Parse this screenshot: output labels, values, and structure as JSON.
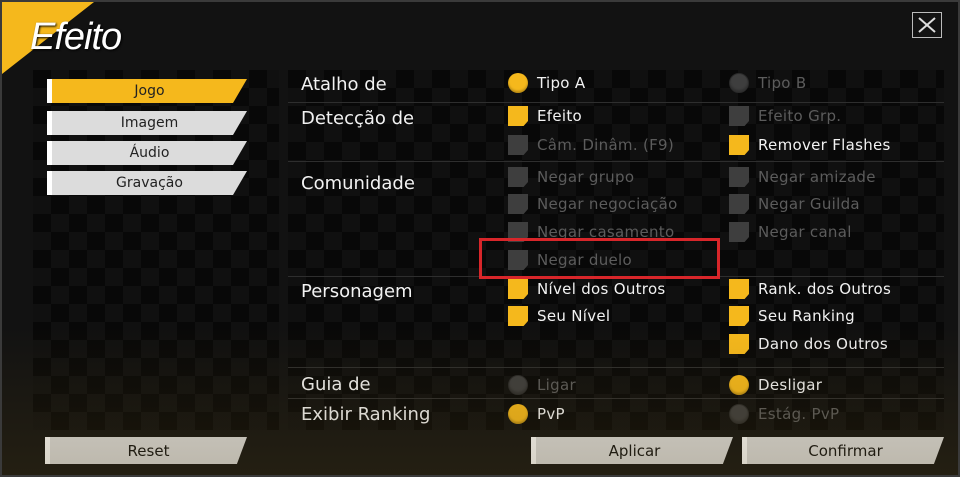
{
  "window": {
    "title": "Efeito"
  },
  "sidebar": {
    "tabs": [
      {
        "label": "Jogo",
        "active": true
      },
      {
        "label": "Imagem",
        "active": false
      },
      {
        "label": "Áudio",
        "active": false
      },
      {
        "label": "Gravação",
        "active": false
      }
    ]
  },
  "settings": {
    "atalho": {
      "label": "Atalho de",
      "opt1": "Tipo A",
      "opt2": "Tipo B"
    },
    "deteccao": {
      "label": "Detecção de",
      "opt1": "Efeito",
      "opt2": "Efeito Grp.",
      "opt3": "Câm. Dinâm. (F9)",
      "opt4": "Remover Flashes"
    },
    "comunidade": {
      "label": "Comunidade",
      "opt1": "Negar grupo",
      "opt2": "Negar amizade",
      "opt3": "Negar negociação",
      "opt4": "Negar Guilda",
      "opt5": "Negar casamento",
      "opt6": "Negar canal",
      "opt7": "Negar duelo"
    },
    "personagem": {
      "label": "Personagem",
      "opt1": "Nível dos Outros",
      "opt2": "Rank. dos Outros",
      "opt3": "Seu Nível",
      "opt4": "Seu Ranking",
      "opt5": "Dano dos Outros"
    },
    "guia": {
      "label": "Guia de",
      "opt1": "Ligar",
      "opt2": "Desligar"
    },
    "ranking": {
      "label": "Exibir Ranking",
      "opt1": "PvP",
      "opt2": "Estág. PvP"
    }
  },
  "buttons": {
    "reset": "Reset",
    "apply": "Aplicar",
    "confirm": "Confirmar"
  },
  "colors": {
    "accent": "#f5b81c",
    "disabled": "#3e3e3e",
    "highlight": "#d8262a"
  },
  "icons": {
    "close": "close-icon"
  }
}
